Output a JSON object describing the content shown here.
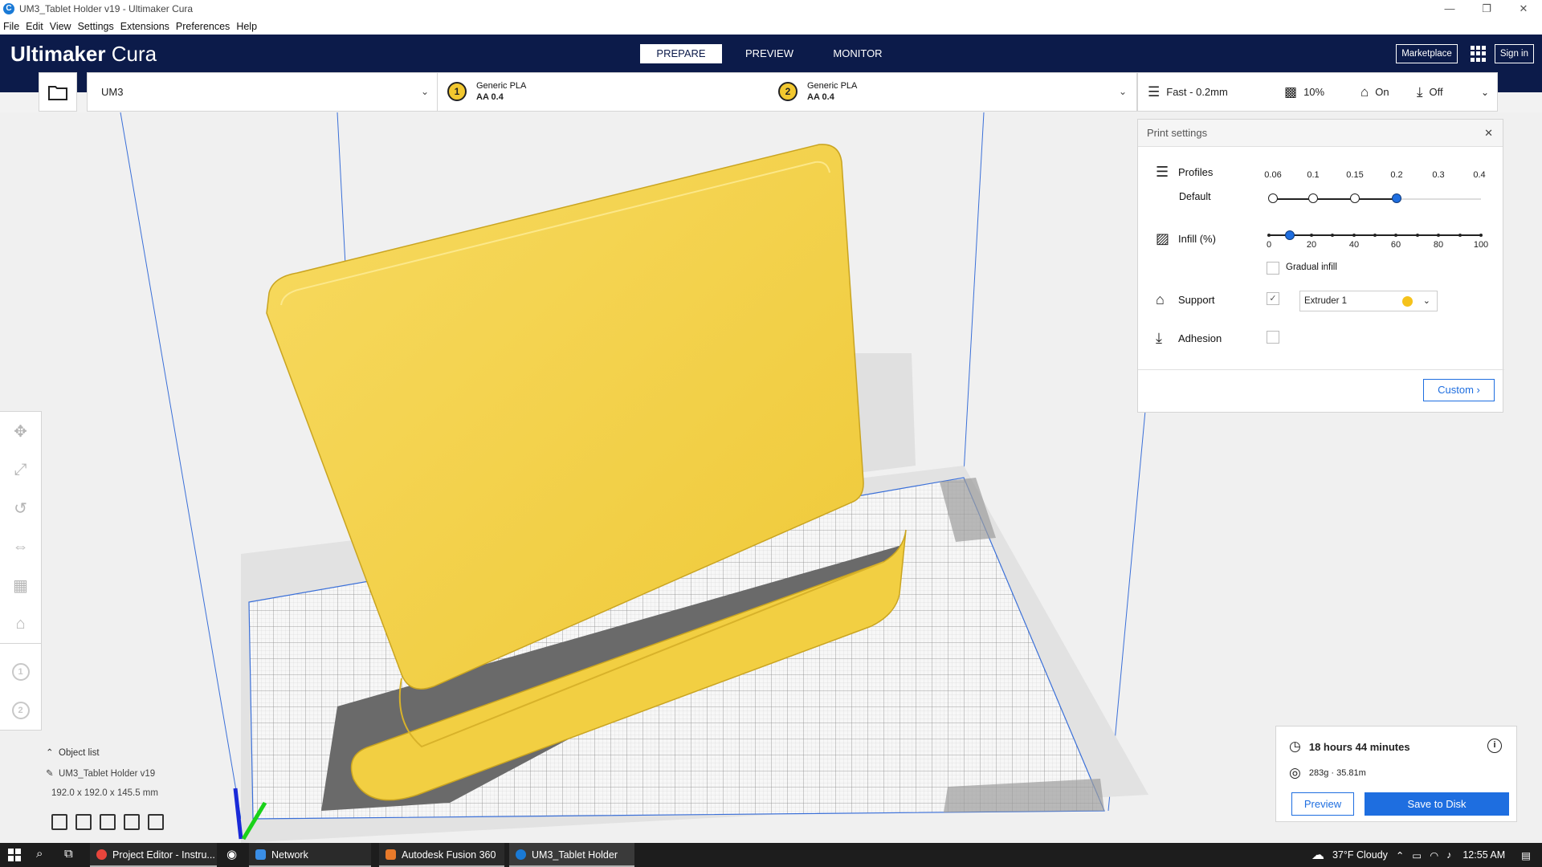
{
  "window": {
    "title": "UM3_Tablet Holder v19 - Ultimaker Cura",
    "controls": [
      "—",
      "❐",
      "✕"
    ]
  },
  "menu": [
    "File",
    "Edit",
    "View",
    "Settings",
    "Extensions",
    "Preferences",
    "Help"
  ],
  "header": {
    "brand_bold": "Ultimaker",
    "brand_light": " Cura",
    "tabs": [
      "PREPARE",
      "PREVIEW",
      "MONITOR"
    ],
    "marketplace": "Marketplace",
    "sign_in": "Sign in"
  },
  "machine": {
    "name": "UM3"
  },
  "extruders": [
    {
      "num": "1",
      "material": "Generic PLA",
      "nozzle": "AA 0.4"
    },
    {
      "num": "2",
      "material": "Generic PLA",
      "nozzle": "AA 0.4"
    }
  ],
  "print_bar": {
    "profile": "Fast - 0.2mm",
    "infill": "10%",
    "support": "On",
    "adhesion": "Off"
  },
  "print_settings": {
    "title": "Print settings",
    "profiles_label": "Profiles",
    "default_label": "Default",
    "profile_ticks": [
      "0.06",
      "0.1",
      "0.15",
      "0.2",
      "0.3",
      "0.4"
    ],
    "infill_label": "Infill (%)",
    "infill_ticks": [
      "0",
      "20",
      "40",
      "60",
      "80",
      "100"
    ],
    "infill_value": 10,
    "gradual_label": "Gradual infill",
    "support_label": "Support",
    "support_extruder": "Extruder 1",
    "adhesion_label": "Adhesion",
    "custom_button": "Custom"
  },
  "object_list": {
    "header": "Object list",
    "object_name": "UM3_Tablet Holder v19",
    "dimensions": "192.0 x 192.0 x 145.5 mm"
  },
  "estimate": {
    "time": "18 hours 44 minutes",
    "material": "283g · 35.81m",
    "preview_button": "Preview",
    "save_button": "Save to Disk"
  },
  "taskbar": {
    "tasks": [
      "Project Editor - Instru...",
      "Network",
      "Autodesk Fusion 360 ...",
      "UM3_Tablet Holder v1..."
    ],
    "weather": "37°F  Cloudy",
    "time": "12:55 AM"
  },
  "colors": {
    "header_bg": "#0c1b4a",
    "accent": "#1e6ee0",
    "model_yellow": "#f5d24a",
    "extruder_yellow": "#f2c82f"
  }
}
